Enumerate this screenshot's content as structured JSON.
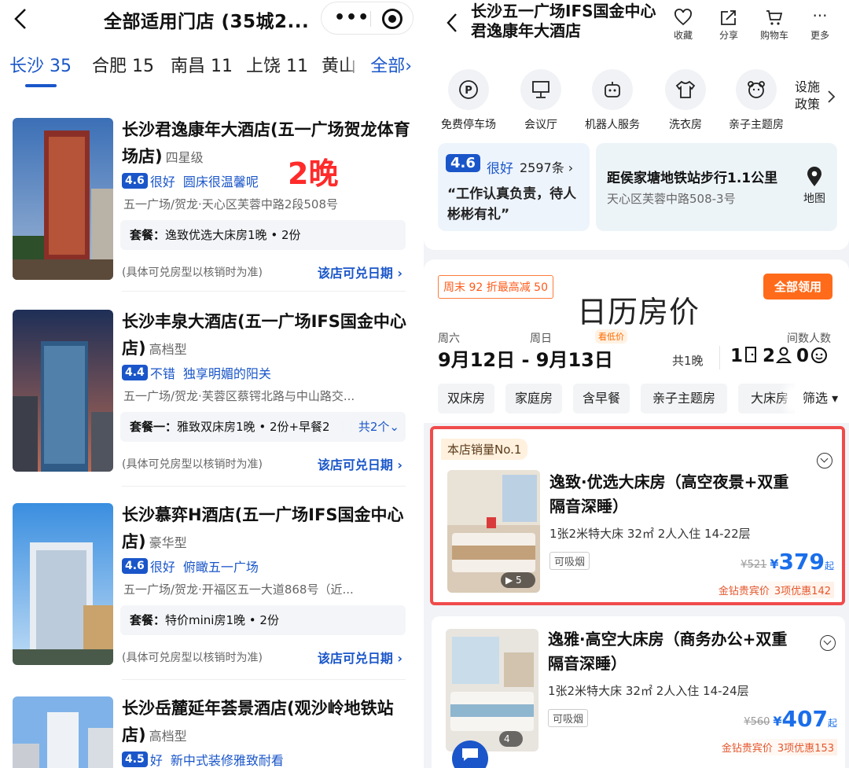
{
  "left": {
    "title": "全部适用门店 (35城2...",
    "city_tabs": [
      {
        "label": "长沙 35"
      },
      {
        "label": "合肥 15"
      },
      {
        "label": "南昌 11"
      },
      {
        "label": "上饶 11"
      },
      {
        "label": "黄山"
      }
    ],
    "all_label": "全部›",
    "annotation": "2晚",
    "hotels": [
      {
        "name": "长沙君逸康年大酒店(五一广场贺龙体育场店)",
        "grade": "四星级",
        "score": "4.6",
        "score_text": "很好",
        "tag": "圆床很温馨呢",
        "address": "五一广场/贺龙·天心区芙蓉中路2段508号",
        "package": "逸致优选大床房1晚 • 2份",
        "package_prefix": "套餐：",
        "package_more": "",
        "note": "(具体可兑房型以核销时为准)",
        "date_link": "该店可兑日期 ›"
      },
      {
        "name": "长沙丰泉大酒店(五一广场IFS国金中心店)",
        "grade": "高档型",
        "score": "4.4",
        "score_text": "不错",
        "tag": "独享明媚的阳关",
        "address": "五一广场/贺龙·芙蓉区蔡锷北路与中山路交...",
        "package": "雅致双床房1晚 • 2份+早餐2",
        "package_prefix": "套餐一：",
        "package_more": "共2个⌄",
        "note": "(具体可兑房型以核销时为准)",
        "date_link": "该店可兑日期 ›"
      },
      {
        "name": "长沙慕弈H酒店(五一广场IFS国金中心店)",
        "grade": "豪华型",
        "score": "4.6",
        "score_text": "很好",
        "tag": "俯瞰五一广场",
        "address": "五一广场/贺龙·开福区五一大道868号（近...",
        "package": "特价mini房1晚 • 2份",
        "package_prefix": "套餐：",
        "package_more": "",
        "note": "(具体可兑房型以核销时为准)",
        "date_link": "该店可兑日期 ›"
      },
      {
        "name": "长沙岳麓延年荟景酒店(观沙岭地铁站店)",
        "grade": "高档型",
        "score": "4.5",
        "score_text": "好",
        "tag": "新中式装修雅致耐看"
      }
    ]
  },
  "right": {
    "title": "长沙五一广场IFS国金中心君逸康年大酒店",
    "actions": [
      {
        "label": "收藏"
      },
      {
        "label": "分享"
      },
      {
        "label": "购物车"
      },
      {
        "label": "更多"
      }
    ],
    "facilities": [
      {
        "label": "免费停车场"
      },
      {
        "label": "会议厅"
      },
      {
        "label": "机器人服务"
      },
      {
        "label": "洗衣房"
      },
      {
        "label": "亲子主题房"
      }
    ],
    "policy_label": "设施 政策",
    "review": {
      "score": "4.6",
      "level": "很好",
      "count": "2597条 ›",
      "quote": "“工作认真负责，待人彬彬有礼”"
    },
    "location": {
      "line1": "距侯家塘地铁站步行1.1公里",
      "line2": "天心区芙蓉中路508-3号",
      "map_label": "地图"
    },
    "promo": "周末 92 折最高减 50",
    "claim_all": "全部领用",
    "annotation": "日历房价",
    "dates": {
      "day1": "周六",
      "day2": "周日",
      "low_price": "看低价",
      "rooms_guests_label": "间数人数",
      "range": "9月12日 - 9月13日",
      "nights": "共1晚",
      "rooms": "1",
      "adults": "2",
      "children": "0"
    },
    "chips": [
      {
        "label": "双床房"
      },
      {
        "label": "家庭房"
      },
      {
        "label": "含早餐"
      },
      {
        "label": "亲子主题房"
      },
      {
        "label": "大床房"
      }
    ],
    "filter": "筛选 ▾",
    "rooms": [
      {
        "badge": "本店销量No.1",
        "name": "逸致·优选大床房（高空夜景+双重隔音深睡）",
        "spec": "1张2米特大床 32㎡ 2人入住 14-22层",
        "tag": "可吸烟",
        "orig_price": "¥521",
        "currency": "¥",
        "price": "379",
        "price_suffix": "起",
        "vip": "金钻贵宾价",
        "offers": "3项优惠142",
        "media_count": "5"
      },
      {
        "badge": "",
        "name": "逸雅·高空大床房（商务办公+双重隔音深睡）",
        "spec": "1张2米特大床 32㎡ 2人入住 14-24层",
        "tag": "可吸烟",
        "orig_price": "¥560",
        "currency": "¥",
        "price": "407",
        "price_suffix": "起",
        "vip": "金钻贵宾价",
        "offers": "3项优惠153",
        "media_count": "4"
      }
    ]
  }
}
